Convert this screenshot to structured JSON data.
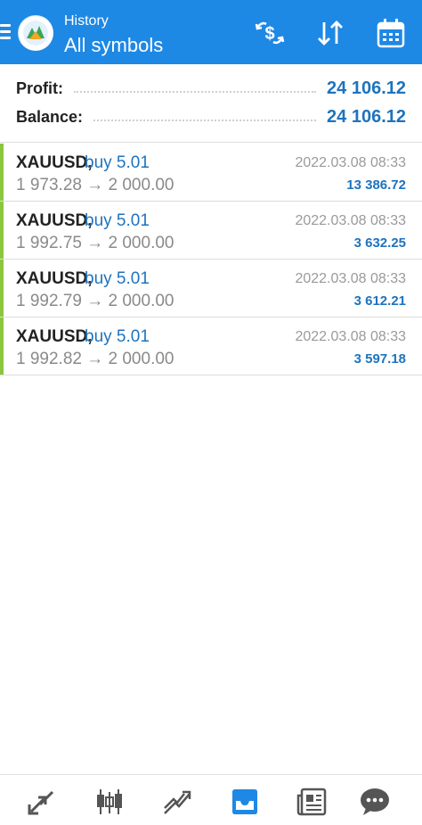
{
  "header": {
    "subtitle": "History",
    "title": "All symbols",
    "icons": [
      "menu-icon",
      "metatrader-logo-icon",
      "currency-exchange-icon",
      "sort-icon",
      "calendar-icon"
    ]
  },
  "summary": {
    "profit_label": "Profit:",
    "profit_value": "24 106.12",
    "balance_label": "Balance:",
    "balance_value": "24 106.12"
  },
  "deals": [
    {
      "symbol": "XAUUSD,",
      "direction": "buy 5.01",
      "prices": "1 973.28 → 2 000.00",
      "time": "2022.03.08 08:33",
      "profit": "13 386.72"
    },
    {
      "symbol": "XAUUSD,",
      "direction": "buy 5.01",
      "prices": "1 992.75 → 2 000.00",
      "time": "2022.03.08 08:33",
      "profit": "3 632.25"
    },
    {
      "symbol": "XAUUSD,",
      "direction": "buy 5.01",
      "prices": "1 992.79 → 2 000.00",
      "time": "2022.03.08 08:33",
      "profit": "3 612.21"
    },
    {
      "symbol": "XAUUSD,",
      "direction": "buy 5.01",
      "prices": "1 992.82 → 2 000.00",
      "time": "2022.03.08 08:33",
      "profit": "3 597.18"
    }
  ],
  "bottom_nav": {
    "items": [
      "quotes-icon",
      "chart-icon",
      "trade-icon",
      "history-icon",
      "news-icon",
      "chat-icon"
    ],
    "active": "history-icon"
  },
  "colors": {
    "header_bg": "#1e88e5",
    "accent_blue": "#1e73be",
    "buy_green": "#8cc63f"
  }
}
